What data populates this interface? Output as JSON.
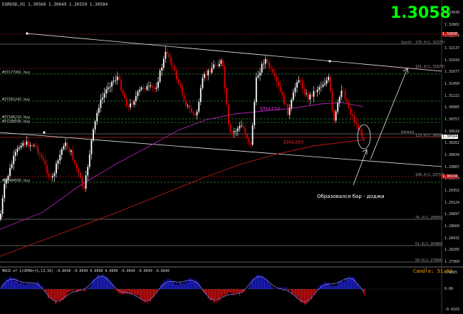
{
  "window": {
    "symbol_header": "EURUSD,H1  1.30569 1.30649 1.30550 1.30584"
  },
  "current_price": "1.3058",
  "price_axis": [
    "1.33030",
    "1.32802",
    "1.32574",
    "1.32137",
    "1.31910",
    "1.31677",
    "1.31450",
    "1.31222",
    "1.30985",
    "1.30757",
    "1.30529",
    "1.30262",
    "1.30034",
    "1.29807",
    "1.29579",
    "1.29352",
    "1.29124",
    "1.28897",
    "1.28660",
    "1.28432",
    "1.28205",
    "1.27960"
  ],
  "current_price_box": "1.30584",
  "price_boxes": [
    "1.33030",
    "1.30134",
    "1.30074"
  ],
  "fib_labels": [
    "South",
    "176.4(1.32370)",
    "161.8(1.31870)",
    "Dehmid",
    "123.6(1.30500)",
    "100.0(1.29713)",
    "76.4(1.28895)",
    "61.8(1.28380)",
    "50.0(1.27960)"
  ],
  "order_labels": [
    "#37177401 buy",
    "#37181242 buy",
    "#37186216 buy",
    "#37208595 buy",
    "#36904595 buy"
  ],
  "ema_labels": {
    "ema150": "EMA150",
    "ema365": "EMA365"
  },
  "annotation": "Образовался бар - доджи",
  "indicator": {
    "header": "MACD of 1(OEMA=(5,13,50) -0.0040 -0.0040 0.0000 0.0000 -0.0040 -0.0040 -0.0040",
    "candle_label": "Candle:  51:02",
    "axis": [
      "0.0065",
      "0.00",
      "-0.0103"
    ]
  },
  "colors": {
    "up": "#ffffff",
    "down": "#e00000",
    "ema150": "#b020b0",
    "ema365": "#c01818",
    "price": "#00ff00",
    "orders": "#2e8b2e",
    "fib": "#8a8a8a"
  }
}
